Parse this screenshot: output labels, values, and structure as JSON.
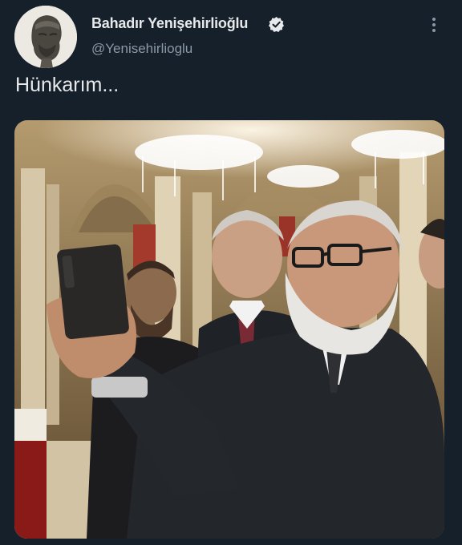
{
  "author": {
    "display_name": "Bahadır Yenişehirlioğlu",
    "handle": "@Yenisehirlioglu",
    "verified_icon": "verified-badge-icon",
    "avatar_icon": "profile-avatar"
  },
  "tweet": {
    "text": "Hünkarım...",
    "media_icon": "photo-selfie"
  },
  "menu": {
    "icon": "more-vertical-icon"
  },
  "colors": {
    "background": "#15202b",
    "text_primary": "#e7e9ea",
    "text_secondary": "#8b98a5"
  }
}
